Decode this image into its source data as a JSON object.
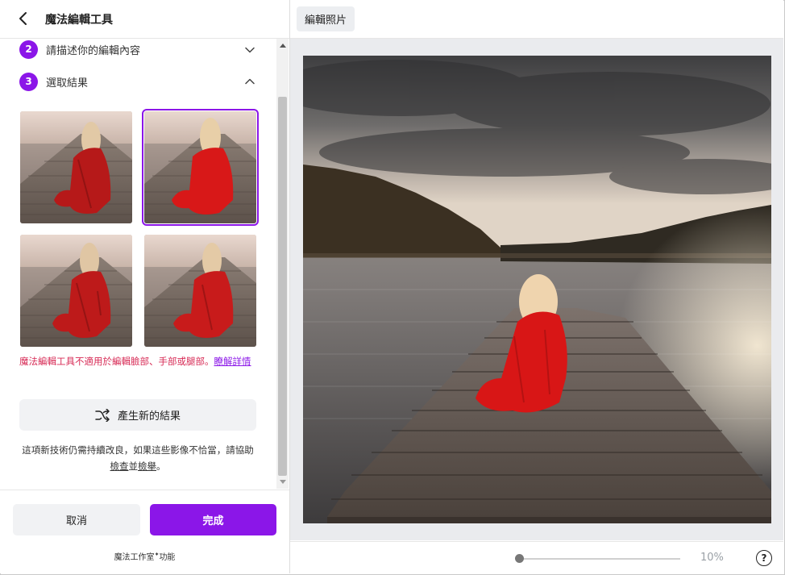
{
  "header": {
    "title": "魔法編輯工具"
  },
  "steps": [
    {
      "number": "2",
      "label": "請描述你的編輯內容",
      "expanded": false
    },
    {
      "number": "3",
      "label": "選取結果",
      "expanded": true
    }
  ],
  "results": {
    "selected_index": 1,
    "count": 4
  },
  "warning": {
    "text": "魔法編輯工具不適用於編輯臉部、手部或腿部。",
    "link": "瞭解詳情"
  },
  "regenerate": {
    "label": "產生新的結果"
  },
  "note": {
    "text_pre": "這項新技術仍需持續改良，如果這些影像不恰當，請協助",
    "link1": "檢查",
    "mid": "並",
    "link2": "檢舉",
    "end": "。"
  },
  "footer": {
    "cancel_label": "取消",
    "done_label": "完成",
    "powered_by": "魔法工作室",
    "powered_suffix": "功能"
  },
  "toolbar": {
    "edit_photo_label": "編輯照片"
  },
  "zoom": {
    "value": "10%",
    "slider_fraction": 0.0
  },
  "help": {
    "label": "?"
  },
  "colors": {
    "accent": "#8b16e8",
    "warning": "#d72a55"
  }
}
